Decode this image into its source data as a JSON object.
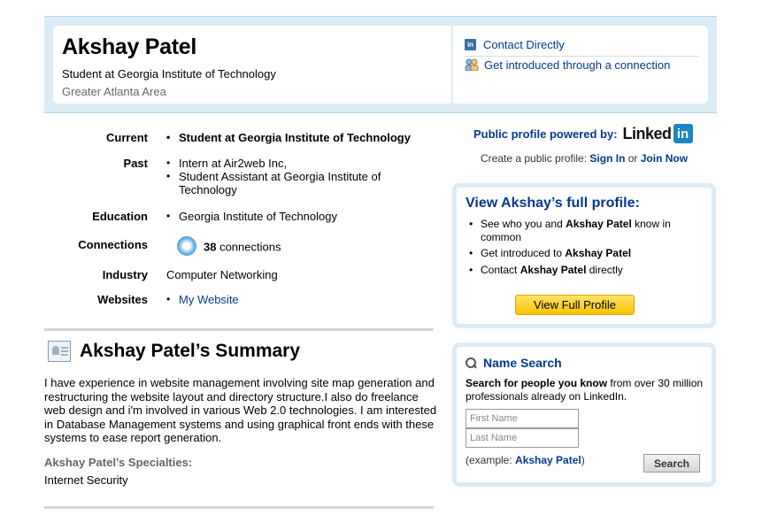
{
  "header": {
    "name": "Akshay Patel",
    "headline": "Student at Georgia Institute of Technology",
    "location": "Greater Atlanta Area",
    "contact_directly": "Contact Directly",
    "get_introduced": "Get introduced through a connection",
    "linkedin_icon_text": "in"
  },
  "details": {
    "current": {
      "label": "Current",
      "items": [
        "Student at Georgia Institute of Technology"
      ]
    },
    "past": {
      "label": "Past",
      "items": [
        "Intern at Air2web Inc,",
        "Student Assistant at Georgia Institute of Technology"
      ]
    },
    "education": {
      "label": "Education",
      "items": [
        "Georgia Institute of Technology"
      ]
    },
    "connections": {
      "label": "Connections",
      "count": "38",
      "suffix": " connections"
    },
    "industry": {
      "label": "Industry",
      "value": "Computer Networking"
    },
    "websites": {
      "label": "Websites",
      "items": [
        "My Website"
      ]
    }
  },
  "summary": {
    "title": "Akshay Patel’s Summary",
    "body": "I have experience in website management involving site map generation and restructuring the website layout and directory structure.I also do freelance web design and i'm involved in various Web 2.0 technologies. I am interested in Database Management systems and using graphical front ends with these systems to ease report generation.",
    "specialties_heading": "Akshay Patel’s Specialties:",
    "specialties": "Internet Security"
  },
  "powered": {
    "text": "Public profile powered by:",
    "brand_word": "Linked",
    "brand_box": "in",
    "create_prefix": "Create a public profile: ",
    "sign_in": "Sign In",
    "or": " or ",
    "join_now": "Join Now"
  },
  "full_profile": {
    "title": "View Akshay’s full profile:",
    "items": [
      {
        "pre": "See who you and ",
        "bold": "Akshay Patel",
        "post": " know in common"
      },
      {
        "pre": "Get introduced to ",
        "bold": "Akshay Patel",
        "post": ""
      },
      {
        "pre": "Contact ",
        "bold": "Akshay Patel",
        "post": " directly"
      }
    ],
    "button": "View Full Profile"
  },
  "name_search": {
    "title": "Name Search",
    "desc_bold": "Search for people you know",
    "desc_rest": " from over 30 million professionals already on LinkedIn.",
    "first_placeholder": "First Name",
    "last_placeholder": "Last Name",
    "example_prefix": "(example: ",
    "example_name": "Akshay Patel",
    "example_suffix": ")",
    "button": "Search"
  },
  "colors": {
    "link_blue": "#06388c",
    "band_blue": "#dcecf6",
    "button_yellow": "#f8c400",
    "linkedin_blue": "#1b86bf"
  },
  "icons": [
    "linkedin-icon",
    "people-icon",
    "connections-icon",
    "summary-icon",
    "search-icon"
  ]
}
